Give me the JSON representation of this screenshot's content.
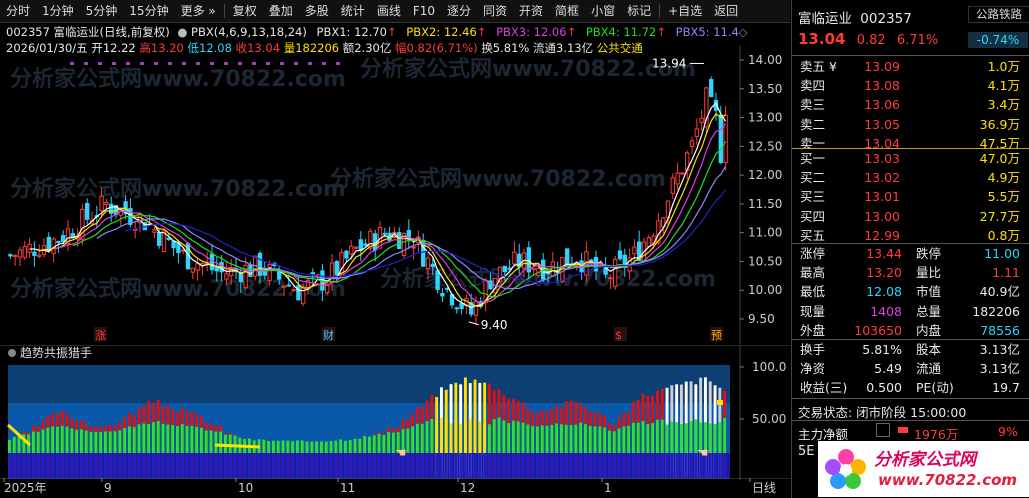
{
  "toolbar": {
    "items": [
      "分时",
      "1分钟",
      "5分钟",
      "15分钟",
      "更多",
      "复权",
      "叠加",
      "多股",
      "统计",
      "画线",
      "F10",
      "逐分",
      "同资",
      "开资",
      "简框",
      "小窗",
      "标记",
      "+自选",
      "返回"
    ]
  },
  "info_line1": {
    "code_name": "002357 富临运业(日线,前复权)",
    "indicator_name": "PBX(4,6,9,13,18,24)",
    "pbx1": "PBX1: 12.70",
    "pbx2": "PBX2: 12.46",
    "pbx3": "PBX3: 12.06",
    "pbx4": "PBX4: 11.72",
    "pbx5": "PBX5: 11.4"
  },
  "info_line2": {
    "date": "2026/01/30/五",
    "open": "开12.22",
    "high": "高13.20",
    "low": "低12.08",
    "close": "收13.04",
    "volume": "量182206",
    "amount": "额2.30亿",
    "change": "幅0.82(6.71%)",
    "turnover": "换5.81%",
    "float": "流通3.13亿",
    "sector": "公共交通"
  },
  "watermark": "分析家公式网www.70822.com",
  "chart": {
    "y_ticks": [
      "14.00",
      "13.50",
      "13.00",
      "12.50",
      "12.00",
      "11.50",
      "11.00",
      "10.50",
      "10.00",
      "9.50"
    ],
    "high_label": "13.94",
    "low_label": "9.40",
    "event_marks": [
      "涨",
      "财",
      "$",
      "预"
    ],
    "sub_title": "趋势共振猎手",
    "sub_ticks": [
      "100.0",
      "50.00"
    ],
    "x_labels": [
      "2025年",
      "9",
      "10",
      "11",
      "12",
      "1",
      "日线"
    ]
  },
  "chart_data": {
    "type": "candlestick",
    "price_axis": [
      9.5,
      14.0
    ],
    "last_close": 13.04,
    "high": 13.94,
    "low": 9.4
  },
  "quote": {
    "name": "富临运业",
    "code": "002357",
    "sector_tag": "公路铁路",
    "price": "13.04",
    "change": "0.82",
    "change_pct": "6.71%",
    "sector_pct": "-0.74%",
    "asks": [
      {
        "label": "卖五 ¥",
        "price": "13.09",
        "vol": "1.0万"
      },
      {
        "label": "卖四",
        "price": "13.08",
        "vol": "4.1万"
      },
      {
        "label": "卖三",
        "price": "13.06",
        "vol": "3.4万"
      },
      {
        "label": "卖二",
        "price": "13.05",
        "vol": "36.9万"
      },
      {
        "label": "卖一",
        "price": "13.04",
        "vol": "47.5万"
      }
    ],
    "bids": [
      {
        "label": "买一",
        "price": "13.03",
        "vol": "47.0万"
      },
      {
        "label": "买二",
        "price": "13.02",
        "vol": "4.9万"
      },
      {
        "label": "买三",
        "price": "13.01",
        "vol": "5.5万"
      },
      {
        "label": "买四",
        "price": "13.00",
        "vol": "27.7万"
      },
      {
        "label": "买五",
        "price": "12.99",
        "vol": "0.8万"
      }
    ],
    "stats": [
      {
        "l1": "涨停",
        "v1": "13.44",
        "c1": "red",
        "l2": "跌停",
        "v2": "11.00",
        "c2": "cyan"
      },
      {
        "l1": "最高",
        "v1": "13.20",
        "c1": "red",
        "l2": "量比",
        "v2": "1.11",
        "c2": "red"
      },
      {
        "l1": "最低",
        "v1": "12.08",
        "c1": "cyan",
        "l2": "市值",
        "v2": "40.9亿",
        "c2": "white"
      },
      {
        "l1": "现量",
        "v1": "1408",
        "c1": "magenta",
        "l2": "总量",
        "v2": "182206",
        "c2": "white"
      },
      {
        "l1": "外盘",
        "v1": "103650",
        "c1": "red",
        "l2": "内盘",
        "v2": "78556",
        "c2": "cyan"
      }
    ],
    "stats2": [
      {
        "l1": "换手",
        "v1": "5.81%",
        "l2": "股本",
        "v2": "3.13亿"
      },
      {
        "l1": "净资",
        "v1": "5.49",
        "l2": "流通",
        "v2": "3.13亿"
      },
      {
        "l1": "收益(三)",
        "v1": "0.500",
        "l2": "PE(动)",
        "v2": "19.7"
      }
    ],
    "trade_status": "交易状态: 闭市阶段 15:00:00",
    "main_flow_label": "主力净额",
    "main_flow_value": "1976万",
    "main_flow_pct": "9%",
    "logo_text": "分析家公式网",
    "logo_url": "www.70822.com",
    "fragment": "5E"
  }
}
